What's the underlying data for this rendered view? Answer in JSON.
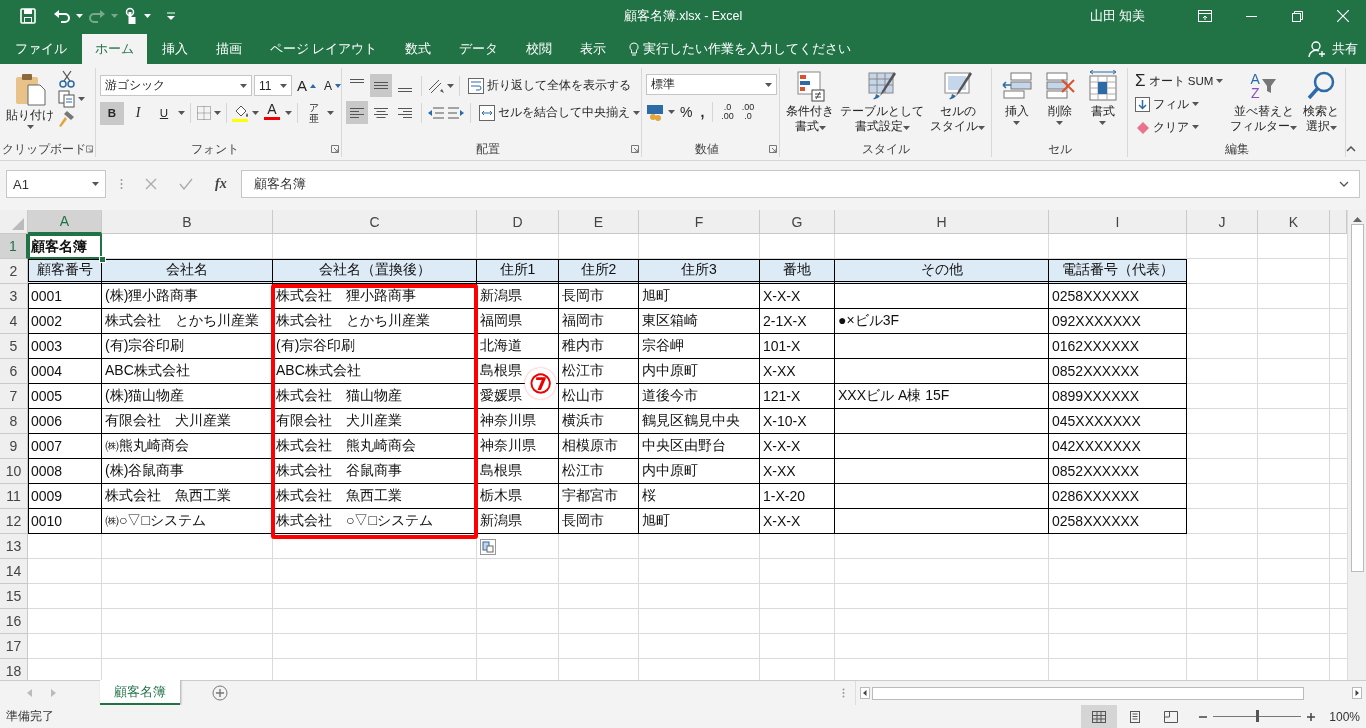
{
  "title_bar": {
    "title": "顧客名簿.xlsx  -  Excel",
    "user": "山田 知美"
  },
  "tabs": [
    {
      "label": "ファイル",
      "selected": false
    },
    {
      "label": "ホーム",
      "selected": true
    },
    {
      "label": "挿入",
      "selected": false
    },
    {
      "label": "描画",
      "selected": false
    },
    {
      "label": "ページ レイアウト",
      "selected": false
    },
    {
      "label": "数式",
      "selected": false
    },
    {
      "label": "データ",
      "selected": false
    },
    {
      "label": "校閲",
      "selected": false
    },
    {
      "label": "表示",
      "selected": false
    }
  ],
  "tell_me": {
    "placeholder": "実行したい作業を入力してください"
  },
  "share": "共有",
  "ribbon": {
    "clipboard": {
      "label": "クリップボード",
      "paste": "貼り付け"
    },
    "font": {
      "label": "フォント",
      "font_name": "游ゴシック",
      "font_size": "11",
      "grow": "A",
      "shrink": "A",
      "bold": {
        "label": "B",
        "on": true
      },
      "italic": {
        "label": "I",
        "on": false
      },
      "underline": {
        "label": "U",
        "on": false
      },
      "font_color": "A",
      "phonetic": "ア亜"
    },
    "alignment": {
      "label": "配置",
      "vertical": [
        {
          "kind": "top",
          "selected": false
        },
        {
          "kind": "middle",
          "selected": true
        },
        {
          "kind": "bottom",
          "selected": false
        }
      ],
      "horizontal": [
        {
          "kind": "left",
          "selected": true
        },
        {
          "kind": "center",
          "selected": false
        },
        {
          "kind": "right",
          "selected": false
        }
      ],
      "wrap_text": "折り返して全体を表示する",
      "merge": "セルを結合して中央揃え"
    },
    "number": {
      "label": "数値",
      "format": "標準",
      "percent": "%",
      "comma": ",",
      "increase_decimal": [
        ".0",
        ".00"
      ],
      "decrease_decimal": [
        ".00",
        ".0"
      ]
    },
    "styles": {
      "label": "スタイル",
      "buttons": [
        {
          "kind": "conditional",
          "lines": [
            "条件付き",
            "書式"
          ]
        },
        {
          "kind": "table",
          "lines": [
            "テーブルとして",
            "書式設定"
          ]
        },
        {
          "kind": "cell",
          "lines": [
            "セルの",
            "スタイル"
          ]
        }
      ]
    },
    "cells": {
      "label": "セル",
      "buttons": [
        {
          "kind": "insert",
          "label": "挿入"
        },
        {
          "kind": "delete",
          "label": "削除"
        },
        {
          "kind": "format",
          "label": "書式"
        }
      ]
    },
    "editing": {
      "label": "編集",
      "autosum_symbol": "Σ",
      "autosum": "オート SUM",
      "fill": "フィル",
      "clear": "クリア",
      "sort_letters": [
        "A",
        "Z"
      ],
      "sort": [
        "並べ替えと",
        "フィルター"
      ],
      "find": [
        "検索と",
        "選択"
      ]
    }
  },
  "formula_bar": {
    "name_box": "A1",
    "fx": "fx",
    "content": "顧客名簿"
  },
  "sheet": {
    "columns": [
      {
        "label": "A",
        "selected": true
      },
      {
        "label": "B",
        "selected": false
      },
      {
        "label": "C",
        "selected": false
      },
      {
        "label": "D",
        "selected": false
      },
      {
        "label": "E",
        "selected": false
      },
      {
        "label": "F",
        "selected": false
      },
      {
        "label": "G",
        "selected": false
      },
      {
        "label": "H",
        "selected": false
      },
      {
        "label": "I",
        "selected": false
      },
      {
        "label": "J",
        "selected": false
      },
      {
        "label": "K",
        "selected": false
      }
    ],
    "rows": [
      {
        "number": "1",
        "selected": true,
        "kind": "title",
        "cells": [
          "顧客名簿"
        ]
      },
      {
        "number": "2",
        "selected": false,
        "kind": "header",
        "cells": [
          "顧客番号",
          "会社名",
          "会社名（置換後）",
          "住所1",
          "住所2",
          "住所3",
          "番地",
          "その他",
          "電話番号（代表）"
        ]
      },
      {
        "number": "3",
        "selected": false,
        "kind": "data",
        "cells": [
          "0001",
          "(株)狸小路商事",
          "株式会社　狸小路商事",
          "新潟県",
          "長岡市",
          "旭町",
          "X-X-X",
          null,
          "0258XXXXXX"
        ]
      },
      {
        "number": "4",
        "selected": false,
        "kind": "data",
        "cells": [
          "0002",
          "株式会社　とかち川産業",
          "株式会社　とかち川産業",
          "福岡県",
          "福岡市",
          "東区箱崎",
          "2-1X-X",
          "●×ビル3F",
          "092XXXXXXX"
        ]
      },
      {
        "number": "5",
        "selected": false,
        "kind": "data",
        "cells": [
          "0003",
          "(有)宗谷印刷",
          "(有)宗谷印刷",
          "北海道",
          "稚内市",
          "宗谷岬",
          "101-X",
          null,
          "0162XXXXXX"
        ]
      },
      {
        "number": "6",
        "selected": false,
        "kind": "data",
        "cells": [
          "0004",
          "ABC株式会社",
          "ABC株式会社",
          "島根県",
          "松江市",
          "内中原町",
          "X-XX",
          null,
          "0852XXXXXX"
        ]
      },
      {
        "number": "7",
        "selected": false,
        "kind": "data",
        "cells": [
          "0005",
          "(株)猫山物産",
          "株式会社　猫山物産",
          "愛媛県",
          "松山市",
          "道後今市",
          "121-X",
          "XXXビル A棟 15F",
          "0899XXXXXX"
        ]
      },
      {
        "number": "8",
        "selected": false,
        "kind": "data",
        "cells": [
          "0006",
          "有限会社　犬川産業",
          "有限会社　犬川産業",
          "神奈川県",
          "横浜市",
          "鶴見区鶴見中央",
          "X-10-X",
          null,
          "045XXXXXXX"
        ]
      },
      {
        "number": "9",
        "selected": false,
        "kind": "data",
        "cells": [
          "0007",
          "㈱熊丸崎商会",
          "株式会社　熊丸崎商会",
          "神奈川県",
          "相模原市",
          "中央区由野台",
          "X-X-X",
          null,
          "042XXXXXXX"
        ]
      },
      {
        "number": "10",
        "selected": false,
        "kind": "data",
        "cells": [
          "0008",
          "(株)谷鼠商事",
          "株式会社　谷鼠商事",
          "島根県",
          "松江市",
          "内中原町",
          "X-XX",
          null,
          "0852XXXXXX"
        ]
      },
      {
        "number": "11",
        "selected": false,
        "kind": "data",
        "cells": [
          "0009",
          "株式会社　魚西工業",
          "株式会社　魚西工業",
          "栃木県",
          "宇都宮市",
          "桜",
          "1-X-20",
          null,
          "0286XXXXXX"
        ]
      },
      {
        "number": "12",
        "selected": false,
        "kind": "data",
        "cells": [
          "0010",
          "㈱○▽□システム",
          "株式会社　○▽□システム",
          "新潟県",
          "長岡市",
          "旭町",
          "X-X-X",
          null,
          "0258XXXXXX"
        ]
      },
      {
        "number": "13",
        "selected": false,
        "kind": "empty"
      },
      {
        "number": "14",
        "selected": false,
        "kind": "empty"
      },
      {
        "number": "15",
        "selected": false,
        "kind": "empty"
      },
      {
        "number": "16",
        "selected": false,
        "kind": "empty"
      },
      {
        "number": "17",
        "selected": false,
        "kind": "empty"
      },
      {
        "number": "18",
        "selected": false,
        "kind": "empty"
      }
    ],
    "annotation": "⑦"
  },
  "sheet_tabs": [
    {
      "label": "顧客名簿",
      "selected": true
    }
  ],
  "status_bar": {
    "text": "準備完了",
    "views": [
      {
        "kind": "normal",
        "selected": true
      },
      {
        "kind": "page_layout",
        "selected": false
      },
      {
        "kind": "page_break",
        "selected": false
      }
    ],
    "zoom_slider": {
      "level": 0.5
    },
    "zoom": "100%"
  }
}
